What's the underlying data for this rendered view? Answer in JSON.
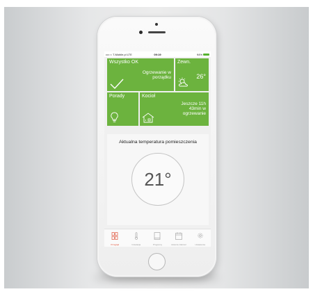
{
  "status_bar": {
    "carrier": "•••○○ T-Mobile.pl  LTE",
    "time": "09:19",
    "battery": "94%"
  },
  "tiles": {
    "status": {
      "title": "Wszystko OK",
      "message_line1": "Ogrzewanie w",
      "message_line2": "porządku",
      "icon": "checkmark-icon"
    },
    "outside": {
      "title": "Zewn.",
      "temperature": "26°",
      "icon": "sun-cloud-icon"
    },
    "tips": {
      "title": "Porady",
      "icon": "lightbulb-icon"
    },
    "boiler": {
      "title": "Kocioł",
      "message_line1": "Jeszcze 11h",
      "message_line2": "43min w",
      "message_line3": "ogrzewanie",
      "icon": "house-heating-icon"
    }
  },
  "room_temperature": {
    "title": "Aktualna temperatura pomieszczenia",
    "value": "21°"
  },
  "tabs": [
    {
      "label": "Przegląd",
      "icon": "grid-icon",
      "active": true
    },
    {
      "label": "Instalacja",
      "icon": "thermometer-icon",
      "active": false
    },
    {
      "label": "Programy",
      "icon": "book-icon",
      "active": false
    },
    {
      "label": "Historia zdarzeń",
      "icon": "calendar-icon",
      "active": false
    },
    {
      "label": "Ustawienia",
      "icon": "gear-icon",
      "active": false
    }
  ],
  "colors": {
    "tile_green": "#6cb33e",
    "active_tab": "#e0533a"
  }
}
